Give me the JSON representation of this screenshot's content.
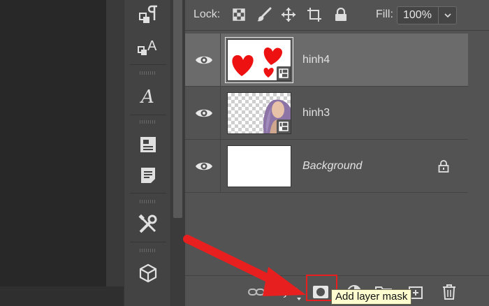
{
  "lock_bar": {
    "lock_label": "Lock:",
    "fill_label": "Fill:",
    "fill_value": "100%"
  },
  "layers": [
    {
      "name": "hinh4",
      "selected": true,
      "visible": true,
      "type": "smart-object"
    },
    {
      "name": "hinh3",
      "selected": false,
      "visible": true,
      "type": "smart-object"
    },
    {
      "name": "Background",
      "selected": false,
      "visible": true,
      "type": "background",
      "locked": true
    }
  ],
  "bottom_bar": {
    "fx_label": "fx"
  },
  "tooltip": {
    "text": "Add layer mask"
  },
  "colors": {
    "panel_bg": "#535353",
    "selected_layer": "#6b6b6b",
    "annotation_red": "#e81f1f",
    "tooltip_bg": "#fdfdd0",
    "heart_red": "#ee1111"
  },
  "icons": {
    "tool_strip": [
      "paragraph-icon",
      "character-style-icon",
      "glyphs-icon",
      "properties-icon",
      "notes-icon",
      "tools-crossed-icon",
      "3d-cube-icon"
    ],
    "lock": [
      "lock-transparent-pixels-icon",
      "lock-image-pixels-icon",
      "lock-position-icon",
      "lock-artboard-icon",
      "lock-all-icon"
    ],
    "bottom_bar": [
      "link-layers-icon",
      "fx-icon",
      "add-layer-mask-icon",
      "adjustment-layer-icon",
      "new-group-icon",
      "new-layer-icon",
      "delete-layer-icon"
    ]
  }
}
